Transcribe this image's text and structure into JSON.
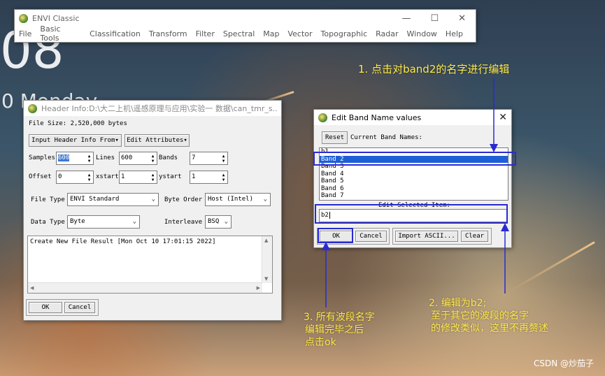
{
  "wallpaper": {
    "clock_fragment": "08",
    "day_fragment": "0 Monday"
  },
  "envi_main": {
    "title": "ENVI Classic",
    "menu": [
      "File",
      "Basic Tools",
      "Classification",
      "Transform",
      "Filter",
      "Spectral",
      "Map",
      "Vector",
      "Topographic",
      "Radar",
      "Window",
      "Help"
    ],
    "controls": {
      "minimize": "—",
      "maximize": "☐",
      "close": "✕"
    }
  },
  "header_info": {
    "title": "Header Info:D:\\大二上机\\遥感原理与应用\\实验一 数据\\can_tmr_s...",
    "file_size": "File Size: 2,520,000 bytes",
    "input_header_btn": "Input Header Info From",
    "edit_attributes_btn": "Edit Attributes",
    "samples_label": "Samples",
    "samples_value": "600",
    "lines_label": "Lines",
    "lines_value": "600",
    "bands_label": "Bands",
    "bands_value": "7",
    "offset_label": "Offset",
    "offset_value": "0",
    "xstart_label": "xstart",
    "xstart_value": "1",
    "ystart_label": "ystart",
    "ystart_value": "1",
    "file_type_label": "File Type",
    "file_type_value": "ENVI Standard",
    "byte_order_label": "Byte Order",
    "byte_order_value": "Host (Intel)",
    "data_type_label": "Data Type",
    "data_type_value": "Byte",
    "interleave_label": "Interleave",
    "interleave_value": "BSQ",
    "log_text": "Create New File Result [Mon Oct 10 17:01:15 2022]",
    "ok_btn": "OK",
    "cancel_btn": "Cancel"
  },
  "edit_band": {
    "title": "Edit Band Name values",
    "close": "✕",
    "reset_btn": "Reset",
    "current_label": "Current Band Names:",
    "bands": [
      "b1",
      "Band 2",
      "Band 3",
      "Band 4",
      "Band 5",
      "Band 6",
      "Band 7"
    ],
    "selected_index": 1,
    "edit_label": "Edit Selected Item:",
    "edit_value": "b2",
    "ok_btn": "OK",
    "cancel_btn": "Cancel",
    "import_btn": "Import ASCII...",
    "clear_btn": "Clear"
  },
  "annotations": {
    "step1": "1. 点击对band2的名字进行编辑",
    "step2_a": "2. 编辑为b2;",
    "step2_b": "至于其它的波段的名字",
    "step2_c": "的修改类似，这里不再赘述",
    "step3_a": "3. 所有波段名字",
    "step3_b": "编辑完毕之后",
    "step3_c": "点击ok",
    "color": "#ffe94a",
    "box_color": "#2a2ad2"
  },
  "watermark": "CSDN @炒茄子"
}
